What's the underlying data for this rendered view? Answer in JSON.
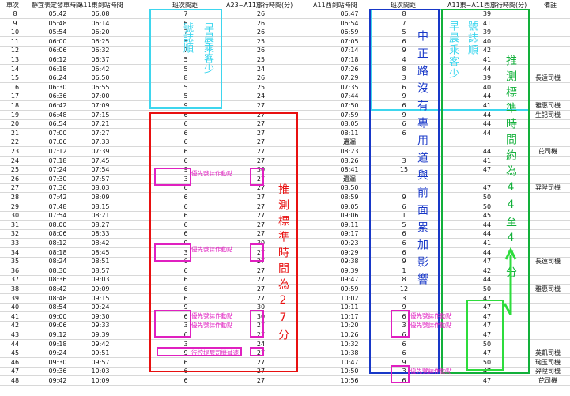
{
  "headers": [
    "車次",
    "靜宜表定發車時間",
    "A11東到站時間",
    "班次間距",
    "A23~A11旅行時間(分)",
    "A11西到站時間",
    "班次間距",
    "A11東~A11西旅行時間(分)",
    "備註"
  ],
  "rows": [
    [
      "8",
      "05:42",
      "06:08",
      "7",
      "26",
      "06:47",
      "8",
      "39",
      ""
    ],
    [
      "9",
      "05:48",
      "06:14",
      "6",
      "26",
      "06:54",
      "7",
      "41",
      ""
    ],
    [
      "10",
      "05:54",
      "06:20",
      "7",
      "26",
      "06:59",
      "5",
      "39",
      ""
    ],
    [
      "11",
      "06:00",
      "06:25",
      "5",
      "25",
      "07:05",
      "6",
      "40",
      ""
    ],
    [
      "12",
      "06:06",
      "06:32",
      "7",
      "26",
      "07:14",
      "9",
      "42",
      ""
    ],
    [
      "13",
      "06:12",
      "06:37",
      "5",
      "25",
      "07:18",
      "4",
      "41",
      ""
    ],
    [
      "14",
      "06:18",
      "06:42",
      "5",
      "24",
      "07:26",
      "8",
      "44",
      ""
    ],
    [
      "15",
      "06:24",
      "06:50",
      "8",
      "26",
      "07:29",
      "3",
      "39",
      "長遠司機"
    ],
    [
      "16",
      "06:30",
      "06:55",
      "5",
      "25",
      "07:35",
      "6",
      "40",
      ""
    ],
    [
      "17",
      "06:36",
      "07:00",
      "5",
      "24",
      "07:44",
      "9",
      "44",
      ""
    ],
    [
      "18",
      "06:42",
      "07:09",
      "9",
      "27",
      "07:50",
      "6",
      "41",
      "雅惠司機"
    ],
    [
      "19",
      "06:48",
      "07:15",
      "6",
      "27",
      "07:59",
      "9",
      "44",
      "生記司機"
    ],
    [
      "20",
      "06:54",
      "07:21",
      "6",
      "27",
      "08:05",
      "6",
      "44",
      ""
    ],
    [
      "21",
      "07:00",
      "07:27",
      "6",
      "27",
      "08:11",
      "6",
      "44",
      ""
    ],
    [
      "22",
      "07:06",
      "07:33",
      "6",
      "27",
      "遺漏",
      "",
      "",
      ""
    ],
    [
      "23",
      "07:12",
      "07:39",
      "6",
      "27",
      "08:23",
      "",
      "44",
      "芘司機"
    ],
    [
      "24",
      "07:18",
      "07:45",
      "6",
      "27",
      "08:26",
      "3",
      "41",
      ""
    ],
    [
      "25",
      "07:24",
      "07:54",
      "9",
      "30",
      "08:41",
      "15",
      "47",
      ""
    ],
    [
      "26",
      "07:30",
      "07:57",
      "3",
      "27",
      "遺漏",
      "",
      "",
      ""
    ],
    [
      "27",
      "07:36",
      "08:03",
      "6",
      "27",
      "08:50",
      "",
      "47",
      "羿陞司機"
    ],
    [
      "28",
      "07:42",
      "08:09",
      "6",
      "27",
      "08:59",
      "9",
      "50",
      ""
    ],
    [
      "29",
      "07:48",
      "08:15",
      "6",
      "27",
      "09:05",
      "6",
      "50",
      ""
    ],
    [
      "30",
      "07:54",
      "08:21",
      "6",
      "27",
      "09:06",
      "1",
      "45",
      ""
    ],
    [
      "31",
      "08:00",
      "08:27",
      "6",
      "27",
      "09:11",
      "5",
      "44",
      ""
    ],
    [
      "32",
      "08:06",
      "08:33",
      "6",
      "27",
      "09:17",
      "6",
      "44",
      ""
    ],
    [
      "33",
      "08:12",
      "08:42",
      "9",
      "30",
      "09:23",
      "6",
      "41",
      ""
    ],
    [
      "34",
      "08:18",
      "08:45",
      "3",
      "27",
      "09:29",
      "6",
      "44",
      ""
    ],
    [
      "35",
      "08:24",
      "08:51",
      "6",
      "27",
      "09:38",
      "9",
      "47",
      "長遠司機"
    ],
    [
      "36",
      "08:30",
      "08:57",
      "6",
      "27",
      "09:39",
      "1",
      "42",
      ""
    ],
    [
      "37",
      "08:36",
      "09:03",
      "6",
      "27",
      "09:47",
      "8",
      "44",
      ""
    ],
    [
      "38",
      "08:42",
      "09:09",
      "6",
      "27",
      "09:59",
      "12",
      "50",
      "雅惠司機"
    ],
    [
      "39",
      "08:48",
      "09:15",
      "6",
      "27",
      "10:02",
      "3",
      "47",
      ""
    ],
    [
      "40",
      "08:54",
      "09:24",
      "9",
      "30",
      "10:11",
      "9",
      "47",
      ""
    ],
    [
      "41",
      "09:00",
      "09:30",
      "6",
      "30",
      "10:17",
      "6",
      "47",
      ""
    ],
    [
      "42",
      "09:06",
      "09:33",
      "3",
      "27",
      "10:20",
      "3",
      "47",
      ""
    ],
    [
      "43",
      "09:12",
      "09:39",
      "6",
      "27",
      "10:26",
      "6",
      "47",
      ""
    ],
    [
      "44",
      "09:18",
      "09:42",
      "3",
      "24",
      "10:32",
      "6",
      "50",
      ""
    ],
    [
      "45",
      "09:24",
      "09:51",
      "9",
      "27",
      "10:38",
      "6",
      "47",
      "英凱司機"
    ],
    [
      "46",
      "09:30",
      "09:57",
      "6",
      "27",
      "10:47",
      "9",
      "50",
      "琬玉司機"
    ],
    [
      "47",
      "09:36",
      "10:03",
      "6",
      "27",
      "10:50",
      "3",
      "47",
      "羿陞司機"
    ],
    [
      "48",
      "09:42",
      "10:09",
      "6",
      "27",
      "10:56",
      "6",
      "47",
      "芘司機"
    ]
  ],
  "annotations": {
    "early_headway": "早晨乘客少",
    "headway_steady": "號誌順",
    "signal_priority": "優先號誌作動點",
    "control_delay": "行控提醒司機減速",
    "road_note": "中正路沒有專用道與前面累加影響",
    "travel_estimate_a23": "推測標準時間為27分",
    "travel_estimate_a11": "推測標準時間約為44至47分"
  },
  "colors": {
    "cyan": "#3ed6ee",
    "red": "#e81010",
    "blue": "#1838c8",
    "green": "#12b03a",
    "magenta": "#e020c0",
    "green_arrow": "#2ddc3c"
  }
}
